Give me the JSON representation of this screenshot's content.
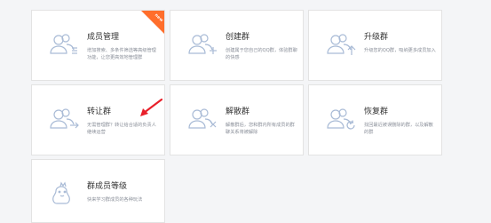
{
  "cards": [
    {
      "title": "成员管理",
      "desc": "增加搜索、多条件筛选等高级管理功能，让您更高效地管理群",
      "badge": "new",
      "icon": "group-members-settings-icon"
    },
    {
      "title": "创建群",
      "desc": "创建属于您自己的QQ群，体验群聊的快感",
      "icon": "group-add-icon"
    },
    {
      "title": "升级群",
      "desc": "升级您的QQ群，吸纳更多成员加入",
      "icon": "group-upgrade-icon"
    },
    {
      "title": "转让群",
      "desc": "无需管理群？转让给合适的负责人继续运营",
      "icon": "group-transfer-icon"
    },
    {
      "title": "解散群",
      "desc": "解散群后，您和群内所有成员的群聊关系将被解除",
      "icon": "group-dissolve-icon"
    },
    {
      "title": "恢复群",
      "desc": "找回最近被误删除的群，以及解散的群",
      "icon": "group-restore-icon"
    },
    {
      "title": "群成员等级",
      "desc": "快来学习群成员的各种玩法",
      "icon": "group-level-icon"
    }
  ],
  "colors": {
    "accent": "#ff6e2c",
    "icon_stroke": "#a9bbd6",
    "arrow": "#e8202a"
  }
}
